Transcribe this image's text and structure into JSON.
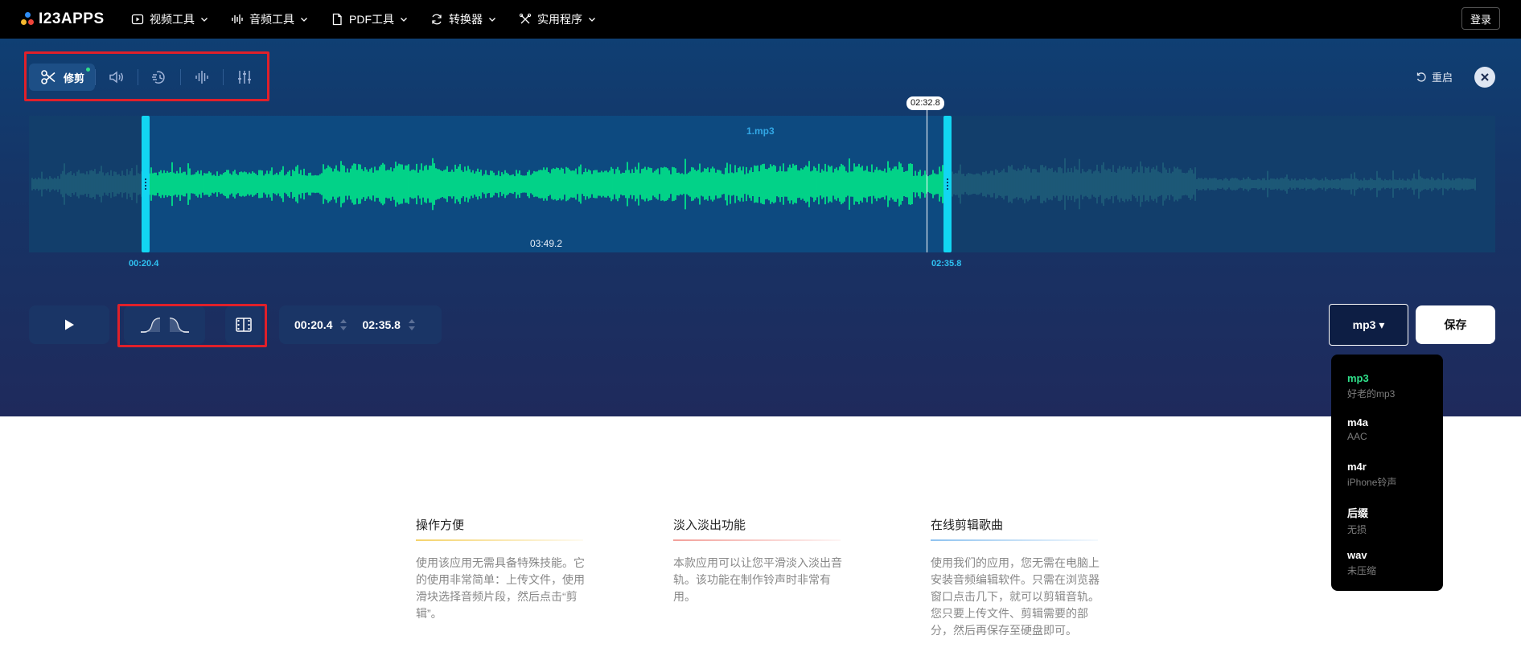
{
  "nav": {
    "logo_text": "I23APPS",
    "items": [
      {
        "label": "视频工具",
        "icon": "video-icon"
      },
      {
        "label": "音频工具",
        "icon": "audio-icon"
      },
      {
        "label": "PDF工具",
        "icon": "pdf-icon"
      },
      {
        "label": "转换器",
        "icon": "converter-icon"
      },
      {
        "label": "实用程序",
        "icon": "utility-icon"
      }
    ],
    "login_label": "登录"
  },
  "toolbar": {
    "active_tool_label": "修剪",
    "tools": [
      "cut-icon",
      "volume-icon",
      "speed-icon",
      "equalizer-wave-icon",
      "sliders-icon"
    ]
  },
  "header_actions": {
    "reset_label": "重启"
  },
  "waveform": {
    "file_name": "1.mp3",
    "playhead_time": "02:32.8",
    "selection_duration": "03:49.2",
    "start_time": "00:20.4",
    "end_time": "02:35.8",
    "colors": {
      "active": "#00f58a",
      "inactive": "#1f5f7a",
      "handle": "#12d6f2"
    }
  },
  "controls": {
    "start_value": "00:20.4",
    "end_value": "02:35.8",
    "format_label": "mp3 ▾",
    "save_label": "保存"
  },
  "format_dropdown": {
    "options": [
      {
        "name": "mp3",
        "desc": "好老的mp3",
        "selected": true
      },
      {
        "name": "m4a",
        "desc": "AAC",
        "selected": false
      },
      {
        "name": "m4r",
        "desc": "iPhone铃声",
        "selected": false
      },
      {
        "name": "后缀",
        "desc": "无损",
        "selected": false
      },
      {
        "name": "wav",
        "desc": "未压缩",
        "selected": false
      }
    ]
  },
  "features": [
    {
      "title": "操作方便",
      "body": "使用该应用无需具备特殊技能。它的使用非常简单：上传文件，使用滑块选择音频片段，然后点击“剪辑”。",
      "accent": "#f5d36b"
    },
    {
      "title": "淡入淡出功能",
      "body": "本款应用可以让您平滑淡入淡出音轨。该功能在制作铃声时非常有用。",
      "accent": "#f3a09a"
    },
    {
      "title": "在线剪辑歌曲",
      "body": "使用我们的应用，您无需在电脑上安装音频编辑软件。只需在浏览器窗口点击几下，就可以剪辑音轨。您只要上传文件、剪辑需要的部分，然后再保存至硬盘即可。",
      "accent": "#8fc3f0"
    }
  ]
}
